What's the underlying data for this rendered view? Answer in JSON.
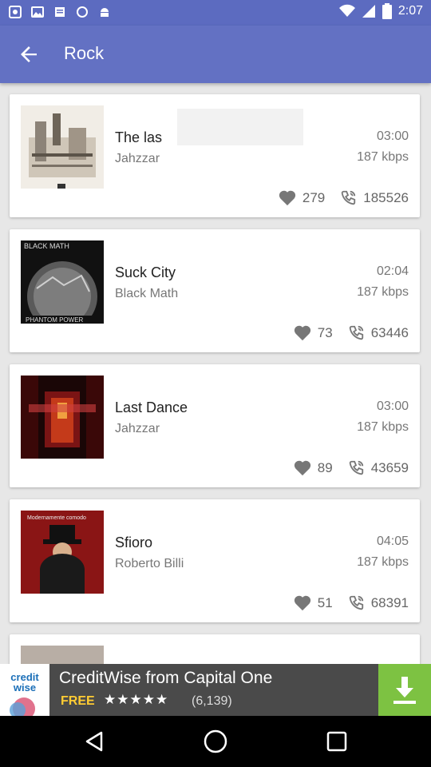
{
  "status_bar": {
    "time": "2:07"
  },
  "app_bar": {
    "title": "Rock"
  },
  "songs": [
    {
      "title": "The las",
      "artist": "Jahzzar",
      "duration": "03:00",
      "bitrate": "187 kbps",
      "likes": "279",
      "plays": "185526",
      "cover": "cover-factory"
    },
    {
      "title": "Suck City",
      "artist": "Black Math",
      "duration": "02:04",
      "bitrate": "187 kbps",
      "likes": "73",
      "plays": "63446",
      "cover": "cover-black-math",
      "cover_text_top": "BLACK MATH",
      "cover_text_bottom": "PHANTOM POWER"
    },
    {
      "title": "Last Dance",
      "artist": "Jahzzar",
      "duration": "03:00",
      "bitrate": "187 kbps",
      "likes": "89",
      "plays": "43659",
      "cover": "cover-red-room"
    },
    {
      "title": "Sfioro",
      "artist": "Roberto Billi",
      "duration": "04:05",
      "bitrate": "187 kbps",
      "likes": "51",
      "plays": "68391",
      "cover": "cover-man-hat",
      "cover_text_top": "Modernamente comodo"
    }
  ],
  "ad": {
    "title": "CreditWise from Capital One",
    "free_label": "FREE",
    "stars": "★★★★★",
    "rating_count": "(6,139)",
    "logo_text": "credit wise",
    "download_icon": "download-icon"
  },
  "nav": {
    "back_icon": "back-triangle-icon",
    "home_icon": "home-circle-icon",
    "recents_icon": "recents-square-icon"
  },
  "colors": {
    "status_bar": "#5c6bc0",
    "app_bar": "#6371c3",
    "ad_download": "#7dc242"
  }
}
